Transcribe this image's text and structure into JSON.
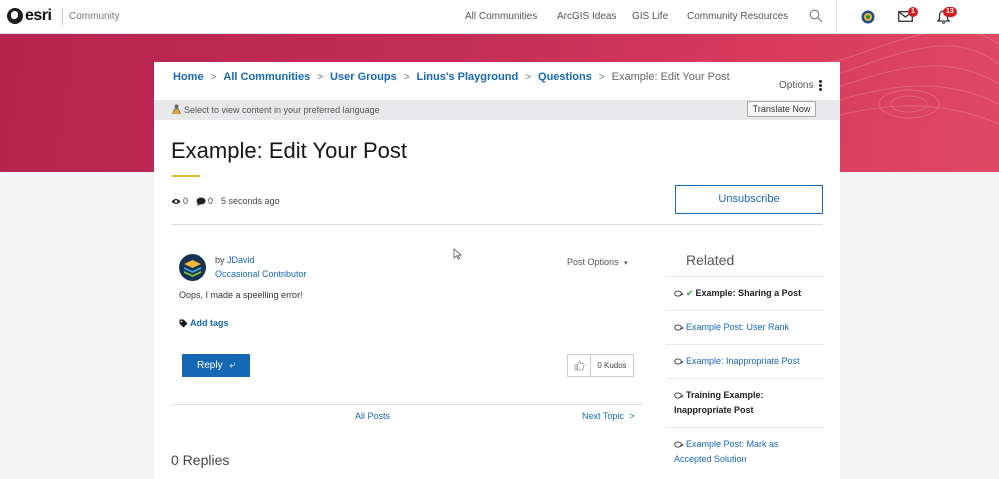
{
  "nav": {
    "logo_text": "esri",
    "community_label": "Community",
    "links": [
      "All Communities",
      "ArcGIS Ideas",
      "GIS Life",
      "Community Resources"
    ],
    "mail_badge": "1",
    "notif_badge": "13"
  },
  "breadcrumb": {
    "items": [
      "Home",
      "All Communities",
      "User Groups",
      "Linus's Playground",
      "Questions"
    ],
    "current": "Example: Edit Your Post",
    "options_label": "Options"
  },
  "translate": {
    "text": "Select to view content in your preferred language",
    "button": "Translate Now"
  },
  "post": {
    "title": "Example: Edit Your Post",
    "views": "0",
    "comments": "0",
    "time": "5 seconds ago",
    "unsubscribe_label": "Unsubscribe",
    "by_label": "by",
    "author": "JDavid",
    "rank": "Occasional Contributor",
    "options_label": "Post Options",
    "body": "Oops, I made a speelling error!",
    "tags_label": "Add tags",
    "reply_label": "Reply",
    "kudos_label": "0 Kudos",
    "all_posts_label": "All Posts",
    "next_topic_label": "Next Topic",
    "replies_label": "0 Replies"
  },
  "related": {
    "title": "Related",
    "items": [
      {
        "label": "Example: Sharing a Post",
        "bold": true,
        "solved": true
      },
      {
        "label": "Example Post: User Rank",
        "bold": false,
        "solved": false
      },
      {
        "label": "Example: Inappropriate Post",
        "bold": false,
        "solved": false
      },
      {
        "label": "Training Example: Inappropriate Post",
        "bold": true,
        "solved": false
      },
      {
        "label": "Example Post: Mark as Accepted Solution",
        "bold": false,
        "solved": false
      }
    ]
  },
  "colors": {
    "accent": "#1768b4",
    "hero": "#c42d56",
    "underline": "#e0b92b",
    "badge": "#d11f1f"
  }
}
